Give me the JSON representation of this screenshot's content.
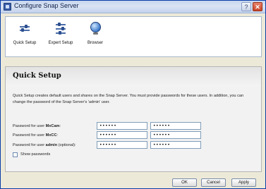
{
  "window": {
    "title": "Configure Snap Server"
  },
  "toolbar": {
    "items": [
      {
        "label": "Quick Setup",
        "icon": "quick-setup-icon"
      },
      {
        "label": "Expert Setup",
        "icon": "expert-setup-icon"
      },
      {
        "label": "Browser",
        "icon": "browser-globe-icon"
      }
    ]
  },
  "panel": {
    "title": "Quick Setup",
    "description": "Quick Setup creates default users and shares on the Snap Server. You must provide passwords for these users. In addition, you can change the password of the Snap Server's 'admin' user.",
    "rows": [
      {
        "label_prefix": "Password for user ",
        "user": "MxCam",
        "label_suffix": ":",
        "password": "••••••",
        "confirm": "••••••"
      },
      {
        "label_prefix": "Password for user ",
        "user": "MxCC",
        "label_suffix": ":",
        "password": "••••••",
        "confirm": "••••••"
      },
      {
        "label_prefix": "Password for user ",
        "user": "admin",
        "label_suffix": " (optional):",
        "password": "••••••",
        "confirm": "••••••"
      }
    ],
    "show_passwords_label": "Show passwords"
  },
  "buttons": {
    "ok": "OK",
    "cancel": "Cancel",
    "apply": "Apply"
  },
  "titlebar": {
    "help": "?",
    "close": "✕"
  }
}
